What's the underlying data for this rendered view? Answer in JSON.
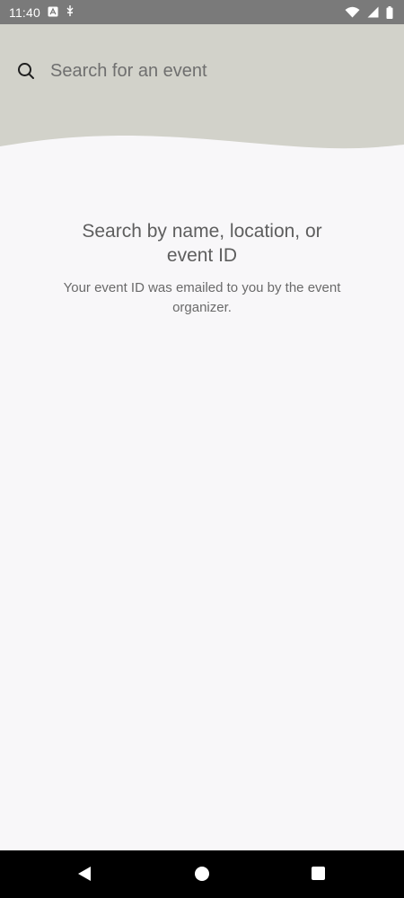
{
  "status_bar": {
    "time": "11:40",
    "icons": [
      "a-notification-icon",
      "usb-icon",
      "wifi-icon",
      "signal-icon",
      "battery-icon"
    ]
  },
  "search": {
    "placeholder": "Search for an event",
    "value": ""
  },
  "empty_state": {
    "title": "Search by name, location, or event ID",
    "subtitle": "Your event ID was emailed to you by the event organizer."
  },
  "colors": {
    "header_bg": "#d2d2ca",
    "page_bg": "#f8f7f9",
    "status_bar_bg": "#7a7a7a",
    "nav_bar_bg": "#000000"
  },
  "nav_bar": {
    "icons": [
      "back-icon",
      "home-icon",
      "recents-icon"
    ]
  }
}
